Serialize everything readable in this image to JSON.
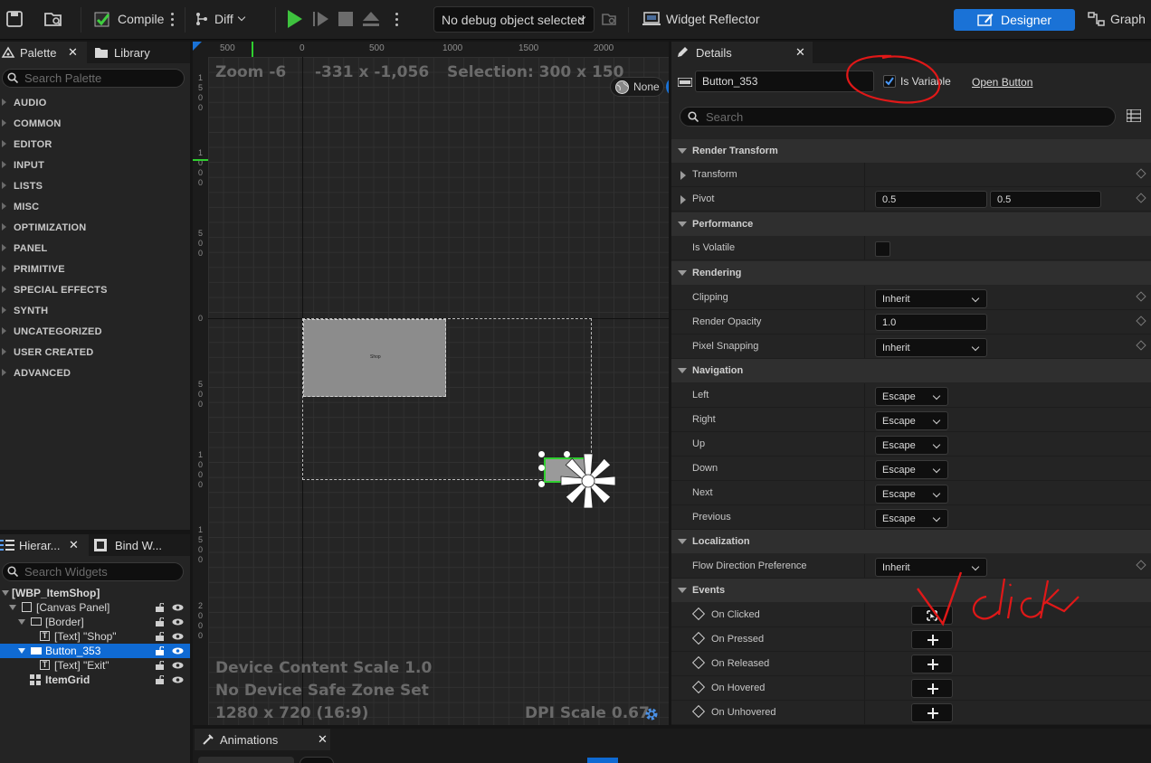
{
  "toolbar": {
    "compile_label": "Compile",
    "diff_label": "Diff",
    "debug_object": "No debug object selected",
    "widget_reflector_label": "Widget Reflector",
    "designer_label": "Designer",
    "graph_label": "Graph"
  },
  "palette": {
    "tab_label": "Palette",
    "library_tab_label": "Library",
    "search_placeholder": "Search Palette",
    "categories": [
      "AUDIO",
      "COMMON",
      "EDITOR",
      "INPUT",
      "LISTS",
      "MISC",
      "OPTIMIZATION",
      "PANEL",
      "PRIMITIVE",
      "SPECIAL EFFECTS",
      "SYNTH",
      "UNCATEGORIZED",
      "USER CREATED",
      "ADVANCED"
    ]
  },
  "hierarchy": {
    "tab_label": "Hierar...",
    "bind_tab_label": "Bind W...",
    "search_placeholder": "Search Widgets",
    "items": [
      {
        "label": "[WBP_ItemShop]"
      },
      {
        "label": "[Canvas Panel]"
      },
      {
        "label": "[Border]"
      },
      {
        "label": "[Text] \"Shop\""
      },
      {
        "label": "Button_353"
      },
      {
        "label": "[Text] \"Exit\""
      },
      {
        "label": "ItemGrid"
      }
    ]
  },
  "viewport": {
    "ruler_top": [
      "500",
      "0",
      "500",
      "1000",
      "1500",
      "2000"
    ],
    "ruler_left": [
      "1500",
      "1000",
      "500",
      "0",
      "500",
      "1000",
      "1500",
      "2000"
    ],
    "zoom": "Zoom -6",
    "cursor_pos": "-331 x -1,056",
    "selection": "Selection: 300 x 150",
    "locale": "None",
    "shop_text": "Shop",
    "device_scale": "Device Content Scale 1.0",
    "safe_zone": "No Device Safe Zone Set",
    "resolution": "1280 x 720 (16:9)",
    "dpi_scale": "DPI Scale 0.67"
  },
  "animations": {
    "tab_label": "Animations"
  },
  "details": {
    "tab_label": "Details",
    "name_value": "Button_353",
    "is_variable_label": "Is Variable",
    "is_variable_checked": true,
    "open_button_label": "Open Button",
    "search_placeholder": "Search",
    "sections": {
      "render_transform": "Render Transform",
      "performance": "Performance",
      "rendering": "Rendering",
      "navigation": "Navigation",
      "localization": "Localization",
      "events": "Events"
    },
    "props": {
      "transform": "Transform",
      "pivot": "Pivot",
      "pivot_x": "0.5",
      "pivot_y": "0.5",
      "is_volatile": "Is Volatile",
      "clipping": "Clipping",
      "clipping_value": "Inherit",
      "render_opacity": "Render Opacity",
      "render_opacity_value": "1.0",
      "pixel_snapping": "Pixel Snapping",
      "pixel_snapping_value": "Inherit",
      "flow_direction": "Flow Direction Preference",
      "flow_direction_value": "Inherit"
    },
    "navigation": [
      {
        "label": "Left",
        "value": "Escape"
      },
      {
        "label": "Right",
        "value": "Escape"
      },
      {
        "label": "Up",
        "value": "Escape"
      },
      {
        "label": "Down",
        "value": "Escape"
      },
      {
        "label": "Next",
        "value": "Escape"
      },
      {
        "label": "Previous",
        "value": "Escape"
      }
    ],
    "events": [
      "On Clicked",
      "On Pressed",
      "On Released",
      "On Hovered",
      "On Unhovered"
    ]
  },
  "colors": {
    "accent": "#1a72d6",
    "selection_green": "#2fcf2f",
    "annotation_red": "#e01818"
  }
}
